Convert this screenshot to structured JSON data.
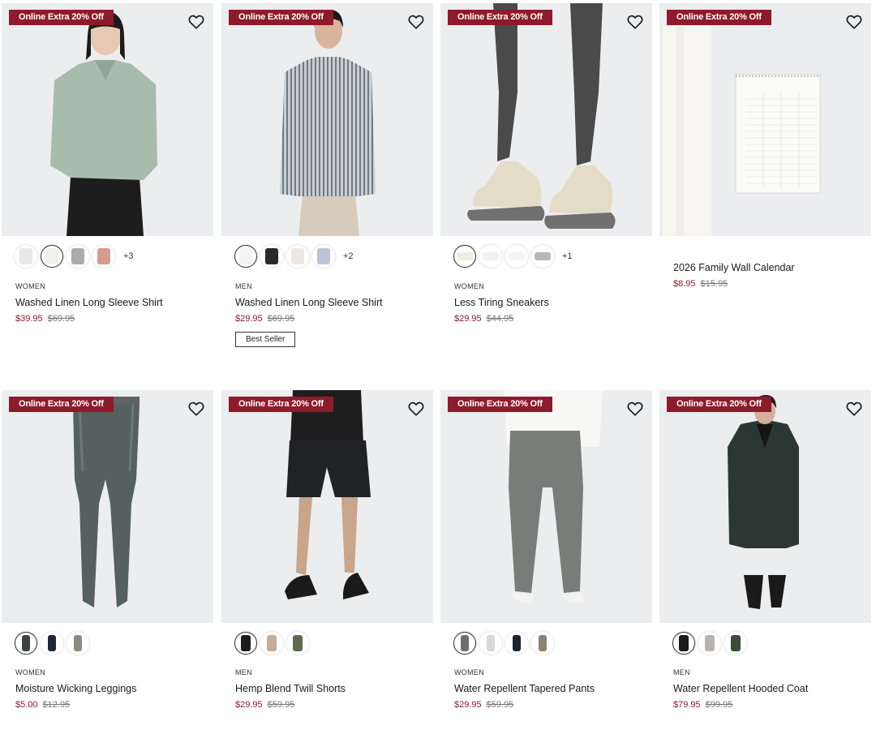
{
  "badge_text": "Online Extra 20% Off",
  "products": [
    {
      "category": "WOMEN",
      "name": "Washed Linen Long Sleeve Shirt",
      "sale_price": "$39.95",
      "original_price": "$69.95",
      "more_colors": "+3",
      "best_seller": "",
      "swatches": [
        "#e8e8e8",
        "#f3efe9",
        "#a9abad",
        "#d49c8e"
      ],
      "selected_swatch": 1
    },
    {
      "category": "MEN",
      "name": "Washed Linen Long Sleeve Shirt",
      "sale_price": "$29.95",
      "original_price": "$69.95",
      "more_colors": "+2",
      "best_seller": "Best Seller",
      "swatches": [
        "#f4f4f4",
        "#2a2a2a",
        "#ece8e1",
        "#b8c6d6"
      ],
      "selected_swatch": 0
    },
    {
      "category": "WOMEN",
      "name": "Less Tiring Sneakers",
      "sale_price": "$29.95",
      "original_price": "$44.95",
      "more_colors": "+1",
      "best_seller": "",
      "swatches": [
        "#f1ece0",
        "#f2f2f2",
        "#f6f6f6",
        "#b8b8b8"
      ],
      "selected_swatch": 0
    },
    {
      "category": "",
      "name": "2026 Family Wall Calendar",
      "sale_price": "$8.95",
      "original_price": "$15.95",
      "more_colors": "",
      "best_seller": "",
      "swatches": [],
      "selected_swatch": -1
    },
    {
      "category": "WOMEN",
      "name": "Moisture Wicking Leggings",
      "sale_price": "$5.00",
      "original_price": "$12.95",
      "more_colors": "",
      "best_seller": "",
      "swatches": [
        "#3d4343",
        "#1f2838",
        "#8c8a84"
      ],
      "selected_swatch": 0
    },
    {
      "category": "MEN",
      "name": "Hemp Blend Twill Shorts",
      "sale_price": "$29.95",
      "original_price": "$59.95",
      "more_colors": "",
      "best_seller": "",
      "swatches": [
        "#1c1c1c",
        "#c4ae96",
        "#5f6a4e"
      ],
      "selected_swatch": 0
    },
    {
      "category": "WOMEN",
      "name": "Water Repellent Tapered Pants",
      "sale_price": "$29.95",
      "original_price": "$59.95",
      "more_colors": "",
      "best_seller": "",
      "swatches": [
        "#6e706e",
        "#d8d8d6",
        "#1d2230",
        "#8a8272"
      ],
      "selected_swatch": 0
    },
    {
      "category": "MEN",
      "name": "Water Repellent Hooded Coat",
      "sale_price": "$79.95",
      "original_price": "$99.95",
      "more_colors": "",
      "best_seller": "",
      "swatches": [
        "#1a1a1a",
        "#b7b5ae",
        "#3d4a36"
      ],
      "selected_swatch": 0
    }
  ],
  "colors": {
    "badge": "#8e1b2b",
    "sale_price": "#8e1b2b",
    "image_background": "#ecedee"
  },
  "icons": {
    "favorite": "heart-outline-icon"
  }
}
